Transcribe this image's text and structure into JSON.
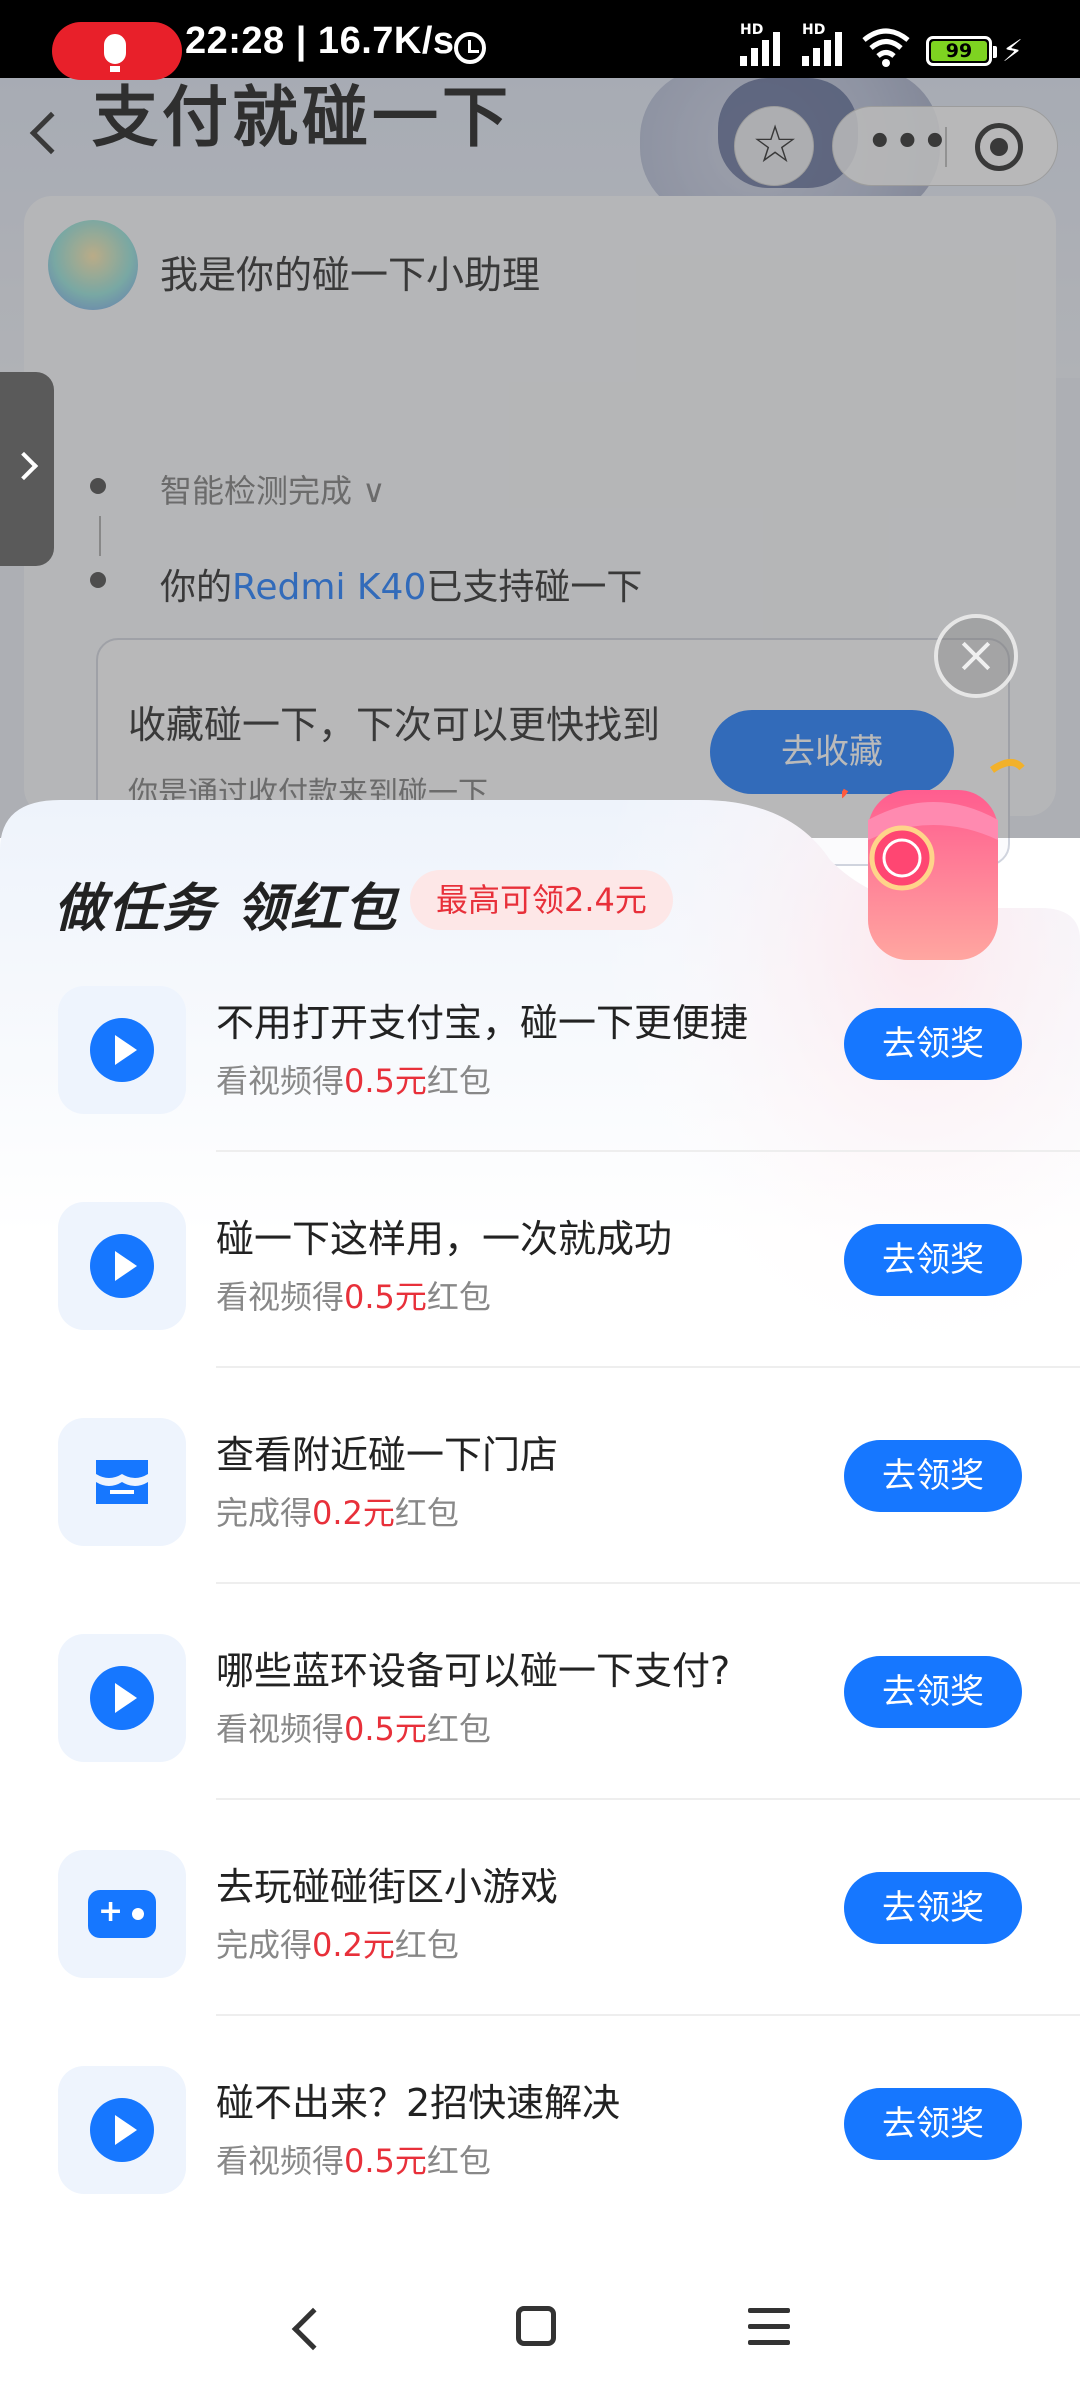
{
  "status_bar": {
    "time_speed": "22:28 | 16.7K/s",
    "signal1": "HD",
    "signal2": "HD",
    "battery": "99",
    "icons": [
      "mic-icon",
      "alarm-icon",
      "signal-icon",
      "wifi-icon",
      "battery-icon",
      "charging-bolt-icon"
    ]
  },
  "background_page": {
    "title": "支付就碰一下",
    "assistant_title": "我是你的碰一下小助理",
    "detect_text": "智能检测完成 ∨",
    "support_prefix": "你的",
    "support_device": "Redmi K40",
    "support_suffix": "已支持碰一下",
    "favorite_title": "收藏碰一下，下次可以更快找到",
    "favorite_sub": "你是通过收付款来到碰一下",
    "favorite_button": "去收藏"
  },
  "sheet": {
    "title": "做任务 领红包",
    "max_badge": "最高可领2.4元",
    "tasks": [
      {
        "title": "不用打开支付宝，碰一下更便捷",
        "sub_prefix": "看视频得",
        "amount": "0.5元",
        "sub_suffix": "红包",
        "button": "去领奖",
        "icon": "play-icon"
      },
      {
        "title": "碰一下这样用，一次就成功",
        "sub_prefix": "看视频得",
        "amount": "0.5元",
        "sub_suffix": "红包",
        "button": "去领奖",
        "icon": "play-icon"
      },
      {
        "title": "查看附近碰一下门店",
        "sub_prefix": "完成得",
        "amount": "0.2元",
        "sub_suffix": "红包",
        "button": "去领奖",
        "icon": "store-icon"
      },
      {
        "title": "哪些蓝环设备可以碰一下支付?",
        "sub_prefix": "看视频得",
        "amount": "0.5元",
        "sub_suffix": "红包",
        "button": "去领奖",
        "icon": "play-icon"
      },
      {
        "title": "去玩碰碰街区小游戏",
        "sub_prefix": "完成得",
        "amount": "0.2元",
        "sub_suffix": "红包",
        "button": "去领奖",
        "icon": "game-icon"
      },
      {
        "title": "碰不出来？2招快速解决",
        "sub_prefix": "看视频得",
        "amount": "0.5元",
        "sub_suffix": "红包",
        "button": "去领奖",
        "icon": "play-icon"
      }
    ]
  },
  "colors": {
    "accent": "#1677ff",
    "amount_red": "#e8303a",
    "recording_red": "#e8202a"
  }
}
